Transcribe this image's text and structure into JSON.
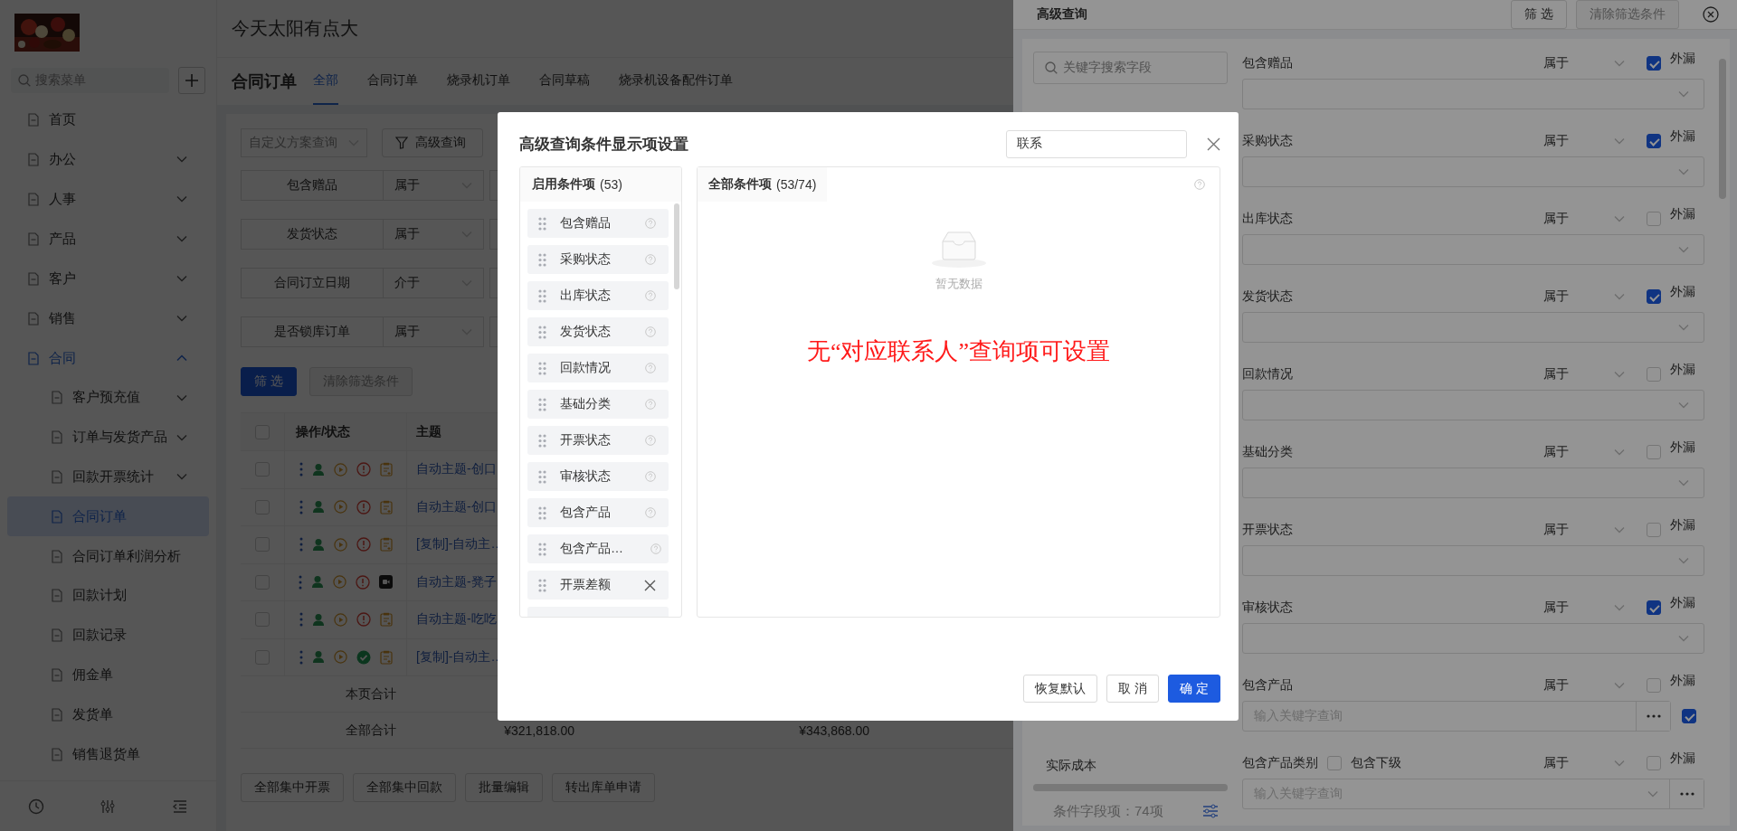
{
  "app": {
    "title": "今天太阳有点大"
  },
  "sidebar": {
    "search": {
      "placeholder": "搜索菜单"
    },
    "items": [
      {
        "label": "首页",
        "selected": false
      },
      {
        "label": "办公",
        "selected": false,
        "expanded": false
      },
      {
        "label": "人事",
        "selected": false,
        "expanded": false
      },
      {
        "label": "产品",
        "selected": false,
        "expanded": false
      },
      {
        "label": "客户",
        "selected": false,
        "expanded": false
      },
      {
        "label": "销售",
        "selected": false,
        "expanded": false
      },
      {
        "label": "合同",
        "selected": false,
        "expanded": true,
        "children": [
          {
            "label": "客户预充值",
            "selected": false,
            "expanded": false
          },
          {
            "label": "订单与发货产品",
            "selected": false,
            "expanded": false
          },
          {
            "label": "回款开票统计",
            "selected": false,
            "expanded": false
          },
          {
            "label": "合同订单",
            "selected": true
          },
          {
            "label": "合同订单利润分析",
            "selected": false
          },
          {
            "label": "回款计划",
            "selected": false
          },
          {
            "label": "回款记录",
            "selected": false
          },
          {
            "label": "佣金单",
            "selected": false
          },
          {
            "label": "发货单",
            "selected": false
          },
          {
            "label": "销售退货单",
            "selected": false
          }
        ]
      }
    ]
  },
  "page": {
    "title": "合同订单",
    "tabs": [
      {
        "label": "全部",
        "selected": true
      },
      {
        "label": "合同订单",
        "selected": false
      },
      {
        "label": "烧录机订单",
        "selected": false
      },
      {
        "label": "合同草稿",
        "selected": false
      },
      {
        "label": "烧录机设备配件订单",
        "selected": false
      }
    ],
    "scheme_select": {
      "placeholder": "自定义方案查询"
    },
    "advanced_button": "高级查询",
    "filters": [
      {
        "label": "包含赠品",
        "operator": "属于"
      },
      {
        "label": "发货状态",
        "operator": "属于"
      },
      {
        "label": "合同订立日期",
        "operator": "介于"
      },
      {
        "label": "是否锁库订单",
        "operator": "属于"
      }
    ],
    "actions": [
      {
        "label": "筛 选",
        "disabled": false
      },
      {
        "label": "清除筛选条件",
        "disabled": true
      }
    ],
    "table": {
      "select_all": {
        "checked": false
      },
      "columns": [
        "操作/状态",
        "主题"
      ],
      "rows": [
        {
          "checked": false,
          "approved": false,
          "media": false,
          "subject": "自动主题-创口"
        },
        {
          "checked": false,
          "approved": false,
          "media": false,
          "subject": "自动主题-创口"
        },
        {
          "checked": false,
          "approved": false,
          "media": false,
          "subject": "[复制]-自动主…"
        },
        {
          "checked": false,
          "approved": false,
          "media": true,
          "subject": "自动主题-凳子"
        },
        {
          "checked": false,
          "approved": false,
          "media": false,
          "subject": "自动主题-吃吃"
        },
        {
          "checked": false,
          "approved": true,
          "media": false,
          "subject": "[复制]-自动主…"
        }
      ],
      "totals": [
        {
          "label": "本页合计"
        },
        {
          "label": "全部合计",
          "amounts": [
            "¥321,818.00",
            "¥343,868.00"
          ]
        }
      ]
    },
    "bulk_buttons": [
      "全部集中开票",
      "全部集中回款",
      "批量编辑",
      "转出库单申请"
    ]
  },
  "drawer": {
    "title": "高级查询",
    "buttons": [
      {
        "label": "筛 选",
        "disabled": false
      },
      {
        "label": "清除筛选条件",
        "disabled": true
      }
    ],
    "field_search": {
      "placeholder": "关键字搜索字段"
    },
    "fields": [
      "实际成本"
    ],
    "field_count": "条件字段项：74项",
    "conditions": [
      {
        "label": "包含赠品",
        "operator": "属于",
        "leak_label": "外漏",
        "leak": true,
        "kind": "select"
      },
      {
        "label": "采购状态",
        "operator": "属于",
        "leak_label": "外漏",
        "leak": true,
        "kind": "select"
      },
      {
        "label": "出库状态",
        "operator": "属于",
        "leak_label": "外漏",
        "leak": false,
        "kind": "select"
      },
      {
        "label": "发货状态",
        "operator": "属于",
        "leak_label": "外漏",
        "leak": true,
        "kind": "select"
      },
      {
        "label": "回款情况",
        "operator": "属于",
        "leak_label": "外漏",
        "leak": false,
        "kind": "select"
      },
      {
        "label": "基础分类",
        "operator": "属于",
        "leak_label": "外漏",
        "leak": false,
        "kind": "select"
      },
      {
        "label": "开票状态",
        "operator": "属于",
        "leak_label": "外漏",
        "leak": false,
        "kind": "select"
      },
      {
        "label": "审核状态",
        "operator": "属于",
        "leak_label": "外漏",
        "leak": true,
        "kind": "select"
      },
      {
        "label": "包含产品",
        "operator": "属于",
        "leak_label": "外漏",
        "leak": false,
        "kind": "lookup",
        "placeholder": "输入关键字查询",
        "exact": true
      },
      {
        "label": "包含产品类别",
        "operator": "属于",
        "leak_label": "外漏",
        "leak": false,
        "kind": "tree",
        "placeholder": "输入关键字查询",
        "include_sub_label": "包含下级",
        "include_sub": false
      }
    ]
  },
  "modal": {
    "title": "高级查询条件显示项设置",
    "search": {
      "value": "联系"
    },
    "enabled": {
      "title": "启用条件项",
      "count": "(53)",
      "items": [
        {
          "label": "包含赠品",
          "removable": false
        },
        {
          "label": "采购状态",
          "removable": false
        },
        {
          "label": "出库状态",
          "removable": false
        },
        {
          "label": "发货状态",
          "removable": false
        },
        {
          "label": "回款情况",
          "removable": false
        },
        {
          "label": "基础分类",
          "removable": false
        },
        {
          "label": "开票状态",
          "removable": false
        },
        {
          "label": "审核状态",
          "removable": false
        },
        {
          "label": "包含产品",
          "removable": false
        },
        {
          "label": "包含产品…",
          "removable": false
        },
        {
          "label": "开票差额",
          "removable": true
        }
      ]
    },
    "all": {
      "title": "全部条件项",
      "count": "(53/74)",
      "empty_text": "暂无数据",
      "note": "无“对应联系人”查询项可设置"
    },
    "buttons": [
      {
        "label": "恢复默认",
        "kind": "default"
      },
      {
        "label": "取 消",
        "kind": "default"
      },
      {
        "label": "确 定",
        "kind": "primary"
      }
    ]
  }
}
